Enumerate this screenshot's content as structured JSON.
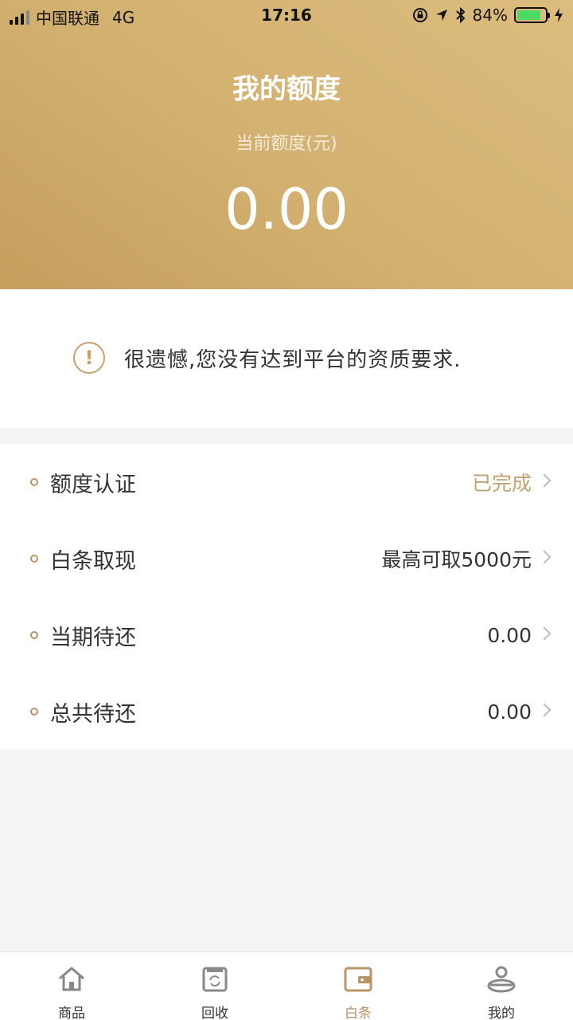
{
  "status_bar": {
    "carrier": "中国联通",
    "network": "4G",
    "time": "17:16",
    "battery": "84%",
    "battery_level": 0.84
  },
  "header": {
    "title": "我的额度",
    "subtitle": "当前额度(元)",
    "amount": "0.00"
  },
  "notice": {
    "icon": "exclamation-circle-icon",
    "text": "很遗憾,您没有达到平台的资质要求."
  },
  "list": [
    {
      "label": "额度认证",
      "value": "已完成"
    },
    {
      "label": "白条取现",
      "value": "最高可取5000元"
    },
    {
      "label": "当期待还",
      "value": "0.00"
    },
    {
      "label": "总共待还",
      "value": "0.00"
    }
  ],
  "tabs": [
    {
      "label": "商品",
      "icon": "home-icon"
    },
    {
      "label": "回收",
      "icon": "recycle-icon"
    },
    {
      "label": "白条",
      "icon": "wallet-icon",
      "active": true
    },
    {
      "label": "我的",
      "icon": "user-icon"
    }
  ],
  "colors": {
    "accent": "#b89466",
    "header_gradient_start": "#c59f5c",
    "header_gradient_end": "#dcbd7e",
    "done": "#c3a172"
  }
}
